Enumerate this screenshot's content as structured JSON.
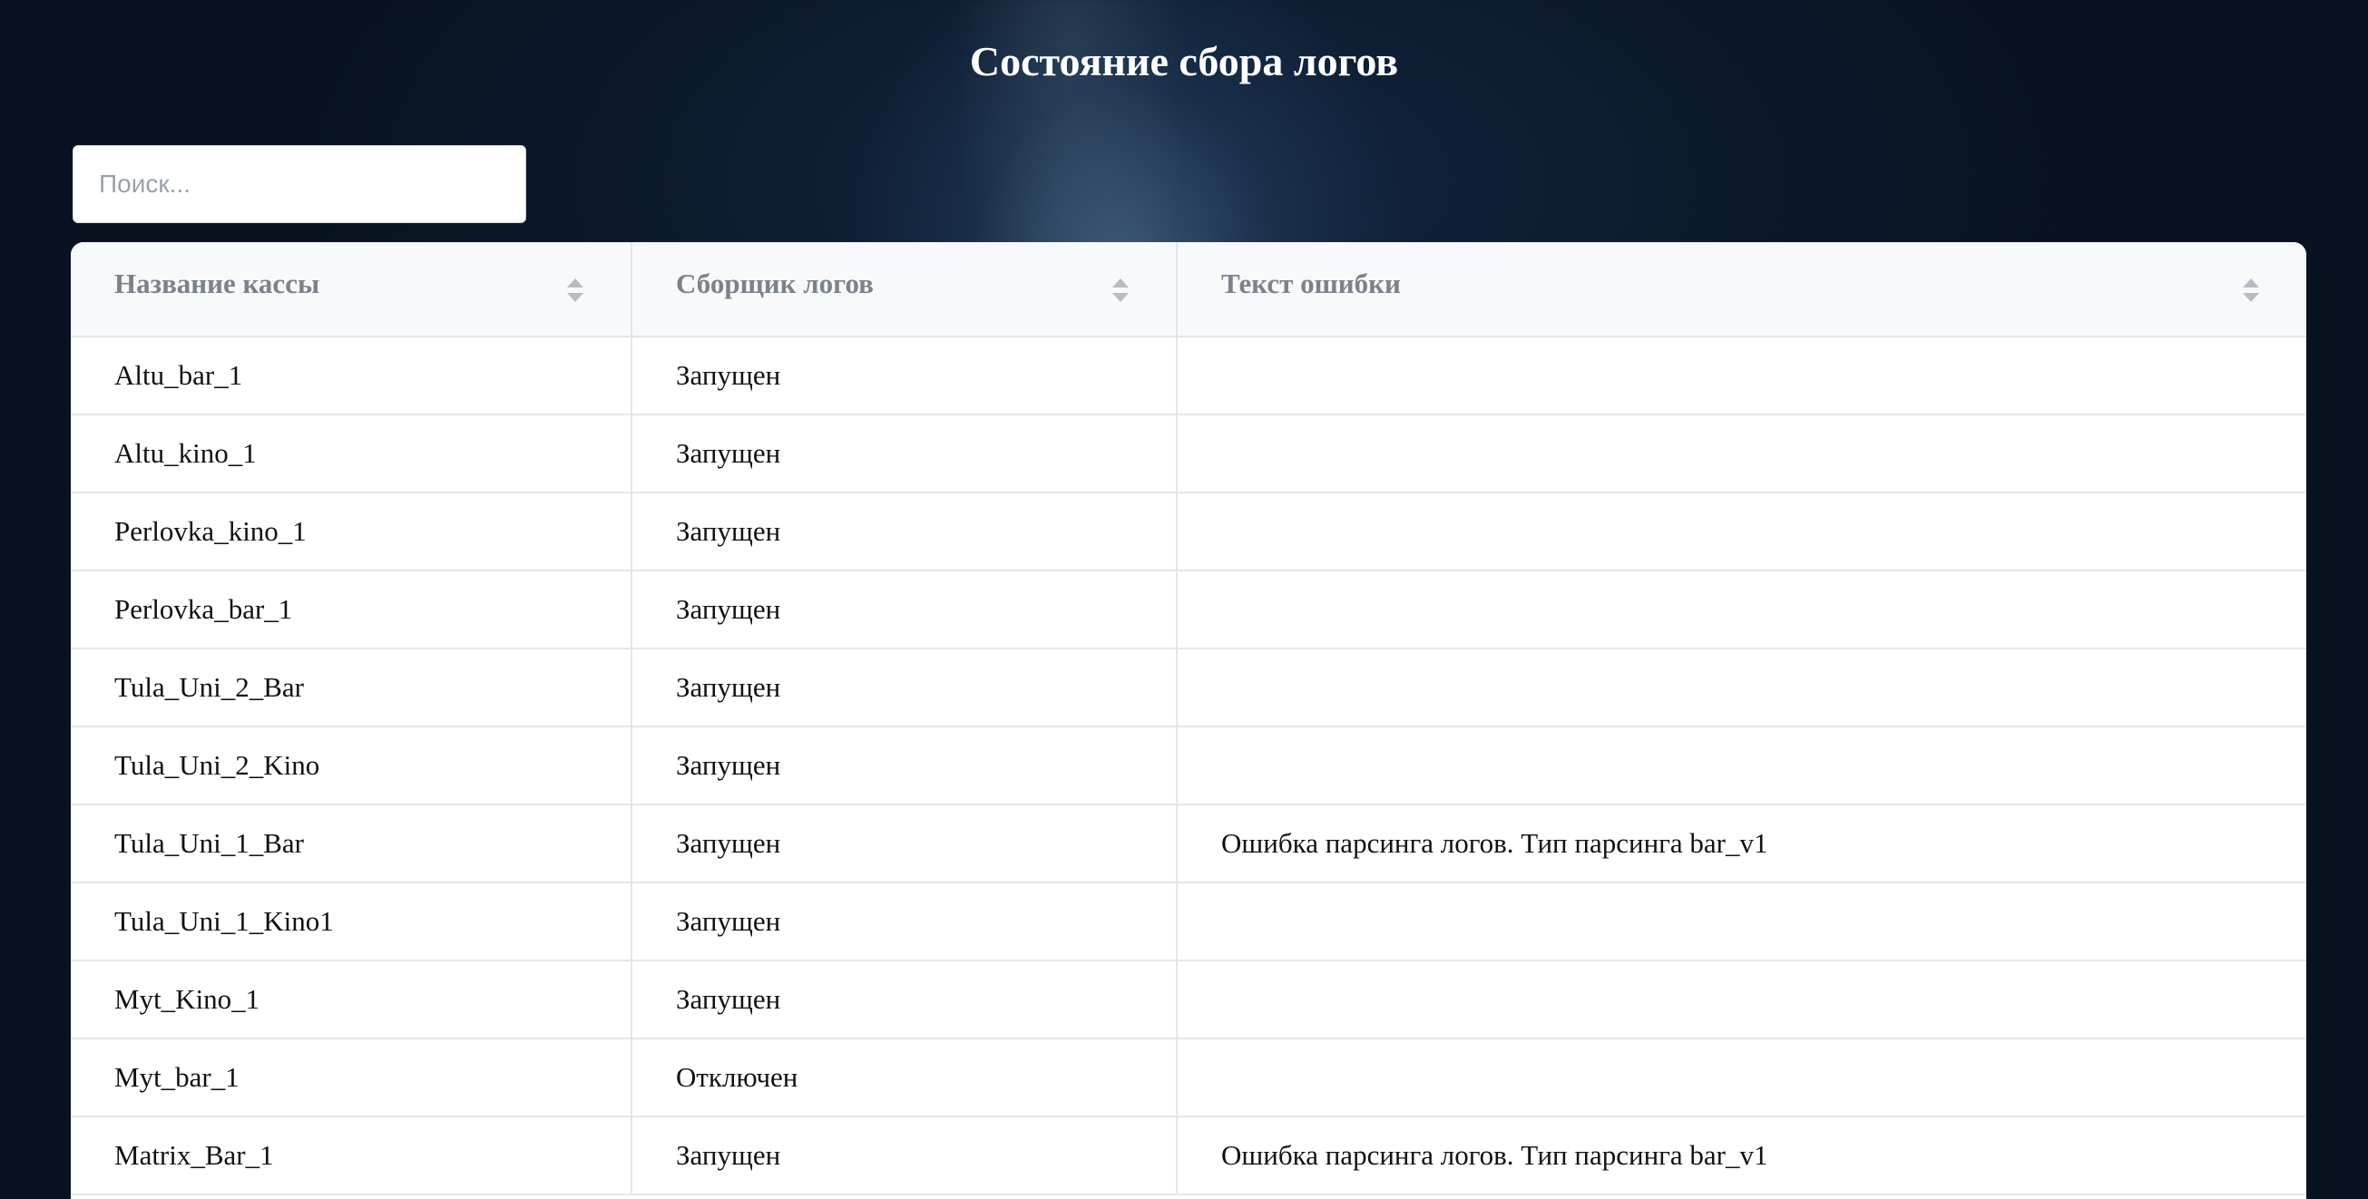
{
  "page": {
    "title": "Состояние сбора логов"
  },
  "search": {
    "placeholder": "Поиск...",
    "value": ""
  },
  "table": {
    "columns": [
      "Название кассы",
      "Сборщик логов",
      "Текст ошибки"
    ],
    "sort_icon": "sort-both-icon",
    "rows": [
      {
        "name": "Altu_bar_1",
        "collector": "Запущен",
        "error": ""
      },
      {
        "name": "Altu_kino_1",
        "collector": "Запущен",
        "error": ""
      },
      {
        "name": "Perlovka_kino_1",
        "collector": "Запущен",
        "error": ""
      },
      {
        "name": "Perlovka_bar_1",
        "collector": "Запущен",
        "error": ""
      },
      {
        "name": "Tula_Uni_2_Bar",
        "collector": "Запущен",
        "error": ""
      },
      {
        "name": "Tula_Uni_2_Kino",
        "collector": "Запущен",
        "error": ""
      },
      {
        "name": "Tula_Uni_1_Bar",
        "collector": "Запущен",
        "error": "Ошибка парсинга логов. Тип парсинга bar_v1"
      },
      {
        "name": "Tula_Uni_1_Kino1",
        "collector": "Запущен",
        "error": ""
      },
      {
        "name": "Myt_Kino_1",
        "collector": "Запущен",
        "error": ""
      },
      {
        "name": "Myt_bar_1",
        "collector": "Отключен",
        "error": ""
      },
      {
        "name": "Matrix_Bar_1",
        "collector": "Запущен",
        "error": "Ошибка парсинга логов. Тип парсинга bar_v1"
      }
    ]
  },
  "colors": {
    "header_bg": "#f8f9fa",
    "header_text": "#7a828b",
    "page_bg": "#060d17",
    "title_text": "#ffffff"
  }
}
